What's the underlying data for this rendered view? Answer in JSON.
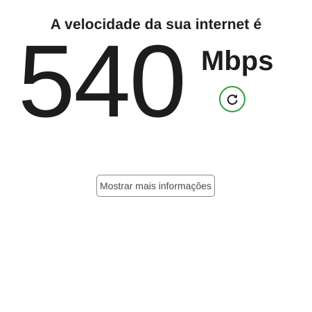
{
  "result": {
    "heading": "A velocidade da sua internet é",
    "speed_value": "540",
    "speed_unit": "Mbps"
  },
  "actions": {
    "refresh_icon": "refresh-icon",
    "more_info_label": "Mostrar mais informações"
  },
  "colors": {
    "accent": "#2e9e3e",
    "text": "#1d1d1d",
    "button_border": "#8a8a8a"
  }
}
